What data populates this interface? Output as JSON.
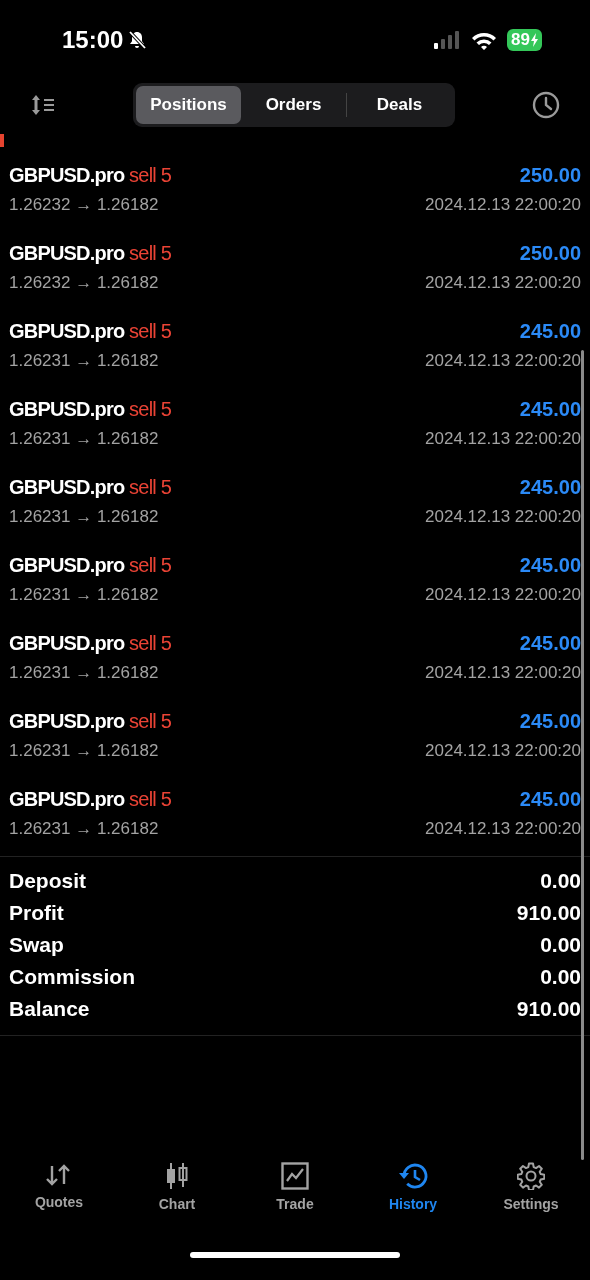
{
  "status_bar": {
    "time": "15:00",
    "battery": "89"
  },
  "tabs": [
    {
      "label": "Positions",
      "selected": true
    },
    {
      "label": "Orders",
      "selected": false
    },
    {
      "label": "Deals",
      "selected": false
    }
  ],
  "deals": [
    {
      "symbol": "GBPUSD.pro",
      "side": "sell 5",
      "prices": "1.26232 → 1.26182",
      "profit": "250.00",
      "time": "2024.12.13 22:00:20"
    },
    {
      "symbol": "GBPUSD.pro",
      "side": "sell 5",
      "prices": "1.26232 → 1.26182",
      "profit": "250.00",
      "time": "2024.12.13 22:00:20"
    },
    {
      "symbol": "GBPUSD.pro",
      "side": "sell 5",
      "prices": "1.26231 → 1.26182",
      "profit": "245.00",
      "time": "2024.12.13 22:00:20"
    },
    {
      "symbol": "GBPUSD.pro",
      "side": "sell 5",
      "prices": "1.26231 → 1.26182",
      "profit": "245.00",
      "time": "2024.12.13 22:00:20"
    },
    {
      "symbol": "GBPUSD.pro",
      "side": "sell 5",
      "prices": "1.26231 → 1.26182",
      "profit": "245.00",
      "time": "2024.12.13 22:00:20"
    },
    {
      "symbol": "GBPUSD.pro",
      "side": "sell 5",
      "prices": "1.26231 → 1.26182",
      "profit": "245.00",
      "time": "2024.12.13 22:00:20"
    },
    {
      "symbol": "GBPUSD.pro",
      "side": "sell 5",
      "prices": "1.26231 → 1.26182",
      "profit": "245.00",
      "time": "2024.12.13 22:00:20"
    },
    {
      "symbol": "GBPUSD.pro",
      "side": "sell 5",
      "prices": "1.26231 → 1.26182",
      "profit": "245.00",
      "time": "2024.12.13 22:00:20"
    },
    {
      "symbol": "GBPUSD.pro",
      "side": "sell 5",
      "prices": "1.26231 → 1.26182",
      "profit": "245.00",
      "time": "2024.12.13 22:00:20"
    }
  ],
  "summary": [
    {
      "label": "Deposit",
      "value": "0.00"
    },
    {
      "label": "Profit",
      "value": "910.00"
    },
    {
      "label": "Swap",
      "value": "0.00"
    },
    {
      "label": "Commission",
      "value": "0.00"
    },
    {
      "label": "Balance",
      "value": "910.00"
    }
  ],
  "bottom_nav": [
    {
      "label": "Quotes",
      "selected": false
    },
    {
      "label": "Chart",
      "selected": false
    },
    {
      "label": "Trade",
      "selected": false
    },
    {
      "label": "History",
      "selected": true
    },
    {
      "label": "Settings",
      "selected": false
    }
  ]
}
